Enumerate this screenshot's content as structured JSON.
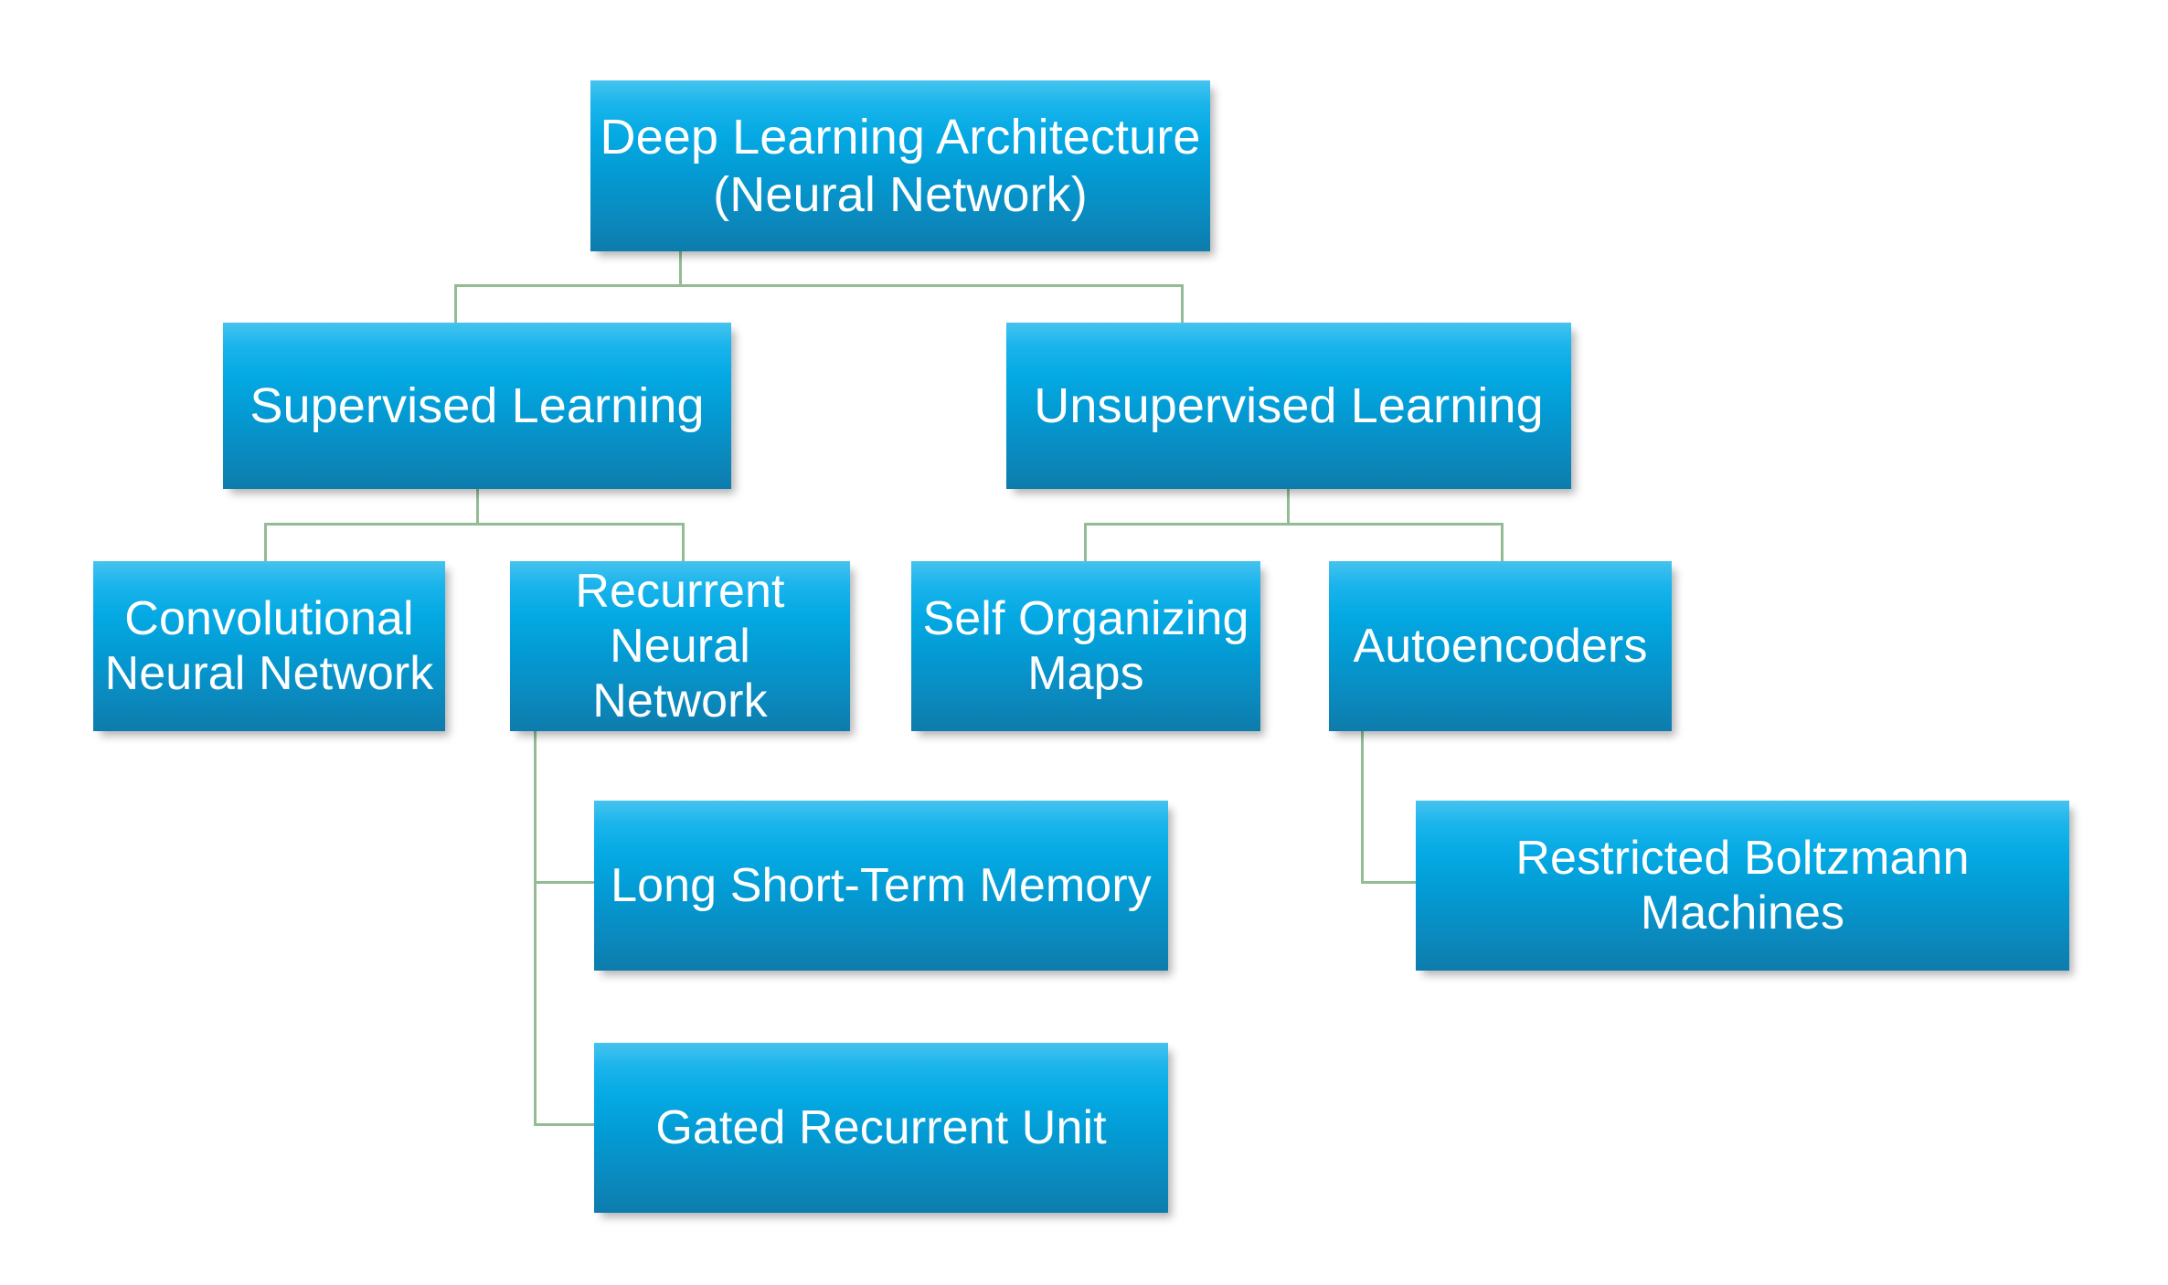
{
  "diagram": {
    "title": "Deep Learning Architecture (Neural Network)",
    "colors": {
      "box_gradient_top": "#45c3ef",
      "box_gradient_mid": "#04a9e3",
      "box_gradient_bottom": "#0d7cac",
      "connector": "#93bc95",
      "text": "#ffffff",
      "background": "#ffffff"
    },
    "nodes": {
      "root": {
        "label": "Deep Learning Architecture\n(Neural Network)"
      },
      "supervised": {
        "label": "Supervised Learning"
      },
      "unsupervised": {
        "label": "Unsupervised Learning"
      },
      "cnn": {
        "label": "Convolutional\nNeural Network"
      },
      "rnn": {
        "label": "Recurrent\nNeural Network"
      },
      "som": {
        "label": "Self Organizing\nMaps"
      },
      "autoencoders": {
        "label": "Autoencoders"
      },
      "lstm": {
        "label": "Long Short-Term Memory"
      },
      "gru": {
        "label": "Gated Recurrent Unit"
      },
      "rbm": {
        "label": "Restricted Boltzmann\nMachines"
      }
    },
    "edges": [
      {
        "from": "root",
        "to": "supervised"
      },
      {
        "from": "root",
        "to": "unsupervised"
      },
      {
        "from": "supervised",
        "to": "cnn"
      },
      {
        "from": "supervised",
        "to": "rnn"
      },
      {
        "from": "unsupervised",
        "to": "som"
      },
      {
        "from": "unsupervised",
        "to": "autoencoders"
      },
      {
        "from": "rnn",
        "to": "lstm"
      },
      {
        "from": "rnn",
        "to": "gru"
      },
      {
        "from": "autoencoders",
        "to": "rbm"
      }
    ]
  }
}
